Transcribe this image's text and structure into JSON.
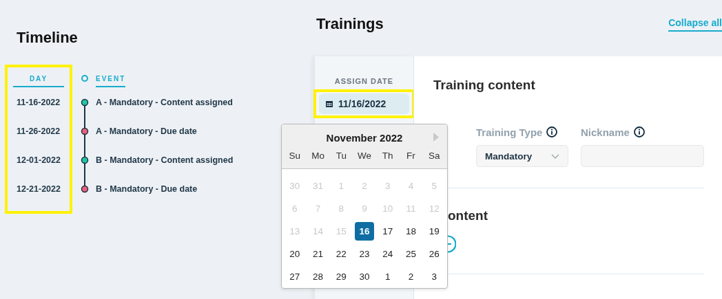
{
  "timeline": {
    "title": "Timeline",
    "day_column": {
      "header": "DAY",
      "highlighted": true
    },
    "event_header": "EVENT",
    "events": [
      {
        "day": "11-16-2022",
        "event": "A - Mandatory - Content assigned",
        "color": "#1fc7a5"
      },
      {
        "day": "11-26-2022",
        "event": "A - Mandatory - Due date",
        "color": "#e8607c"
      },
      {
        "day": "12-01-2022",
        "event": "B - Mandatory - Content assigned",
        "color": "#1fc7a5"
      },
      {
        "day": "12-21-2022",
        "event": "B - Mandatory - Due date",
        "color": "#e8607c"
      }
    ]
  },
  "trainings": {
    "title": "Trainings",
    "collapse_link": "Collapse all",
    "assign_date": {
      "label": "ASSIGN DATE",
      "value": "11/16/2022",
      "highlighted": true
    },
    "section_title": "Training content",
    "training_type": {
      "label": "Training Type",
      "value": "Mandatory"
    },
    "nickname": {
      "label": "Nickname"
    },
    "content_title": "ontent"
  },
  "calendar": {
    "month": "November 2022",
    "weekdays": [
      "Su",
      "Mo",
      "Tu",
      "We",
      "Th",
      "Fr",
      "Sa"
    ],
    "weeks": [
      [
        {
          "label": "30",
          "muted": true,
          "selected": false
        },
        {
          "label": "31",
          "muted": true,
          "selected": false
        },
        {
          "label": "1",
          "muted": true,
          "selected": false
        },
        {
          "label": "2",
          "muted": true,
          "selected": false
        },
        {
          "label": "3",
          "muted": true,
          "selected": false
        },
        {
          "label": "4",
          "muted": true,
          "selected": false
        },
        {
          "label": "5",
          "muted": true,
          "selected": false
        }
      ],
      [
        {
          "label": "6",
          "muted": true,
          "selected": false
        },
        {
          "label": "7",
          "muted": true,
          "selected": false
        },
        {
          "label": "8",
          "muted": true,
          "selected": false
        },
        {
          "label": "9",
          "muted": true,
          "selected": false
        },
        {
          "label": "10",
          "muted": true,
          "selected": false
        },
        {
          "label": "11",
          "muted": true,
          "selected": false
        },
        {
          "label": "12",
          "muted": true,
          "selected": false
        }
      ],
      [
        {
          "label": "13",
          "muted": true,
          "selected": false
        },
        {
          "label": "14",
          "muted": true,
          "selected": false
        },
        {
          "label": "15",
          "muted": true,
          "selected": false
        },
        {
          "label": "16",
          "muted": false,
          "selected": true
        },
        {
          "label": "17",
          "muted": false,
          "selected": false
        },
        {
          "label": "18",
          "muted": false,
          "selected": false
        },
        {
          "label": "19",
          "muted": false,
          "selected": false
        }
      ],
      [
        {
          "label": "20",
          "muted": false,
          "selected": false
        },
        {
          "label": "21",
          "muted": false,
          "selected": false
        },
        {
          "label": "22",
          "muted": false,
          "selected": false
        },
        {
          "label": "23",
          "muted": false,
          "selected": false
        },
        {
          "label": "24",
          "muted": false,
          "selected": false
        },
        {
          "label": "25",
          "muted": false,
          "selected": false
        },
        {
          "label": "26",
          "muted": false,
          "selected": false
        }
      ],
      [
        {
          "label": "27",
          "muted": false,
          "selected": false
        },
        {
          "label": "28",
          "muted": false,
          "selected": false
        },
        {
          "label": "29",
          "muted": false,
          "selected": false
        },
        {
          "label": "30",
          "muted": false,
          "selected": false
        },
        {
          "label": "1",
          "muted": false,
          "selected": false
        },
        {
          "label": "2",
          "muted": false,
          "selected": false
        },
        {
          "label": "3",
          "muted": false,
          "selected": false
        }
      ]
    ]
  }
}
